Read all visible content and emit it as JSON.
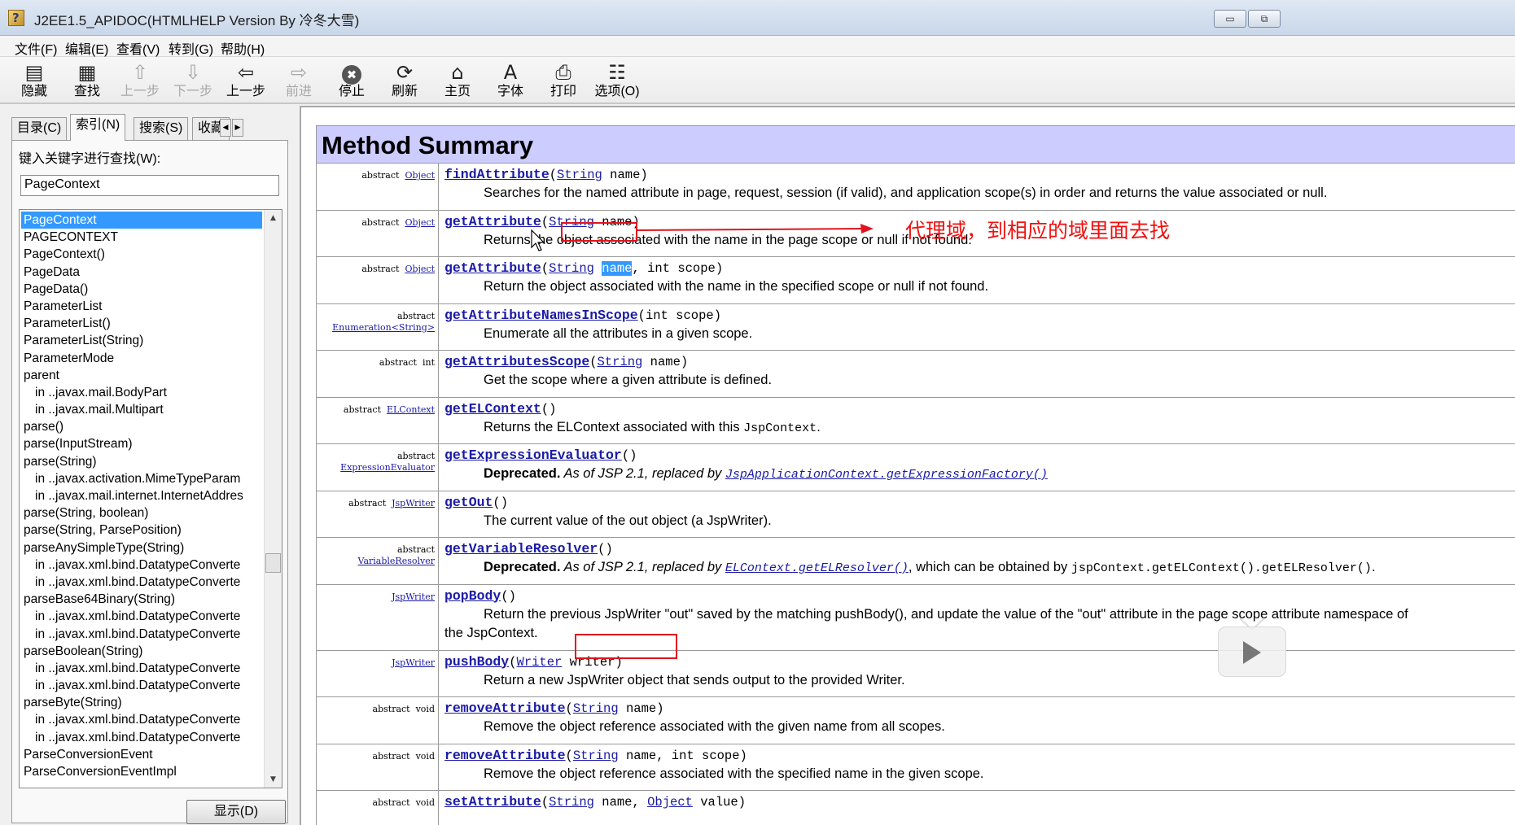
{
  "window": {
    "title": "J2EE1.5_APIDOC(HTMLHELP Version By 冷冬大雪)",
    "min_label": "▭",
    "max_label": "⧉"
  },
  "menubar": [
    "文件(F)",
    "编辑(E)",
    "查看(V)",
    "转到(G)",
    "帮助(H)"
  ],
  "toolbar": [
    {
      "label": "隐藏",
      "icon": "hide-icon",
      "glyph": "▤",
      "enabled": true
    },
    {
      "label": "查找",
      "icon": "find-icon",
      "glyph": "▦",
      "enabled": true
    },
    {
      "label": "上一步",
      "icon": "prev-topic-icon",
      "glyph": "⇧",
      "enabled": false
    },
    {
      "label": "下一步",
      "icon": "next-topic-icon",
      "glyph": "⇩",
      "enabled": false
    },
    {
      "label": "上一步",
      "icon": "back-arrow-icon",
      "glyph": "⇦",
      "enabled": true
    },
    {
      "label": "前进",
      "icon": "forward-arrow-icon",
      "glyph": "⇨",
      "enabled": false
    },
    {
      "label": "停止",
      "icon": "stop-icon",
      "glyph": "✖",
      "enabled": true
    },
    {
      "label": "刷新",
      "icon": "refresh-icon",
      "glyph": "⟳",
      "enabled": true
    },
    {
      "label": "主页",
      "icon": "home-icon",
      "glyph": "⌂",
      "enabled": true
    },
    {
      "label": "字体",
      "icon": "font-icon",
      "glyph": "A",
      "enabled": true
    },
    {
      "label": "打印",
      "icon": "print-icon",
      "glyph": "⎙",
      "enabled": true
    },
    {
      "label": "选项(O)",
      "icon": "options-icon",
      "glyph": "☷",
      "enabled": true
    }
  ],
  "sidebar": {
    "tabs": [
      {
        "label": "目录(C)",
        "active": false
      },
      {
        "label": "索引(N)",
        "active": true
      },
      {
        "label": "搜索(S)",
        "active": false
      },
      {
        "label": "收藏",
        "active": false
      }
    ],
    "keyword_label": "键入关键字进行查找(W):",
    "keyword_value": "PageContext",
    "index_items": [
      {
        "text": "PageContext",
        "sub": false,
        "selected": true
      },
      {
        "text": "PAGECONTEXT",
        "sub": false
      },
      {
        "text": "PageContext()",
        "sub": false
      },
      {
        "text": "PageData",
        "sub": false
      },
      {
        "text": "PageData()",
        "sub": false
      },
      {
        "text": "ParameterList",
        "sub": false
      },
      {
        "text": "ParameterList()",
        "sub": false
      },
      {
        "text": "ParameterList(String)",
        "sub": false
      },
      {
        "text": "ParameterMode",
        "sub": false
      },
      {
        "text": "parent",
        "sub": false
      },
      {
        "text": "in ..javax.mail.BodyPart",
        "sub": true
      },
      {
        "text": "in ..javax.mail.Multipart",
        "sub": true
      },
      {
        "text": "parse()",
        "sub": false
      },
      {
        "text": "parse(InputStream)",
        "sub": false
      },
      {
        "text": "parse(String)",
        "sub": false
      },
      {
        "text": "in ..javax.activation.MimeTypeParam",
        "sub": true
      },
      {
        "text": "in ..javax.mail.internet.InternetAddres",
        "sub": true
      },
      {
        "text": "parse(String, boolean)",
        "sub": false
      },
      {
        "text": "parse(String, ParsePosition)",
        "sub": false
      },
      {
        "text": "parseAnySimpleType(String)",
        "sub": false
      },
      {
        "text": "in ..javax.xml.bind.DatatypeConverte",
        "sub": true
      },
      {
        "text": "in ..javax.xml.bind.DatatypeConverte",
        "sub": true
      },
      {
        "text": "parseBase64Binary(String)",
        "sub": false
      },
      {
        "text": "in ..javax.xml.bind.DatatypeConverte",
        "sub": true
      },
      {
        "text": "in ..javax.xml.bind.DatatypeConverte",
        "sub": true
      },
      {
        "text": "parseBoolean(String)",
        "sub": false
      },
      {
        "text": "in ..javax.xml.bind.DatatypeConverte",
        "sub": true
      },
      {
        "text": "in ..javax.xml.bind.DatatypeConverte",
        "sub": true
      },
      {
        "text": "parseByte(String)",
        "sub": false
      },
      {
        "text": "in ..javax.xml.bind.DatatypeConverte",
        "sub": true
      },
      {
        "text": "in ..javax.xml.bind.DatatypeConverte",
        "sub": true
      },
      {
        "text": "ParseConversionEvent",
        "sub": false
      },
      {
        "text": "ParseConversionEventImpl",
        "sub": false
      }
    ],
    "show_button": "显示(D)"
  },
  "content": {
    "heading": "Method Summary",
    "methods": [
      {
        "mod": "abstract",
        "type": "Object",
        "type_link": true,
        "name": "findAttribute",
        "params": [
          {
            "t": "String",
            "link": true,
            "n": "name"
          }
        ],
        "desc": "Searches for the named attribute in page, request, session (if valid), and application scope(s) in order and returns the value associated or null."
      },
      {
        "mod": "abstract",
        "type": "Object",
        "type_link": true,
        "name": "getAttribute",
        "params": [
          {
            "t": "String",
            "link": true,
            "n": "name"
          }
        ],
        "desc": "Returns the object associated with the name in the page scope or null if not found."
      },
      {
        "mod": "abstract",
        "type": "Object",
        "type_link": true,
        "name": "getAttribute",
        "params": [
          {
            "t": "String",
            "link": true,
            "n": "name",
            "hl": true
          },
          {
            "t": "int",
            "link": false,
            "n": "scope"
          }
        ],
        "desc": "Return the object associated with the name in the specified scope or null if not found."
      },
      {
        "mod": "abstract",
        "type": "Enumeration<String>",
        "type_link": true,
        "two_line_mod": true,
        "name": "getAttributeNamesInScope",
        "params": [
          {
            "t": "int",
            "link": false,
            "n": "scope"
          }
        ],
        "desc": "Enumerate all the attributes in a given scope."
      },
      {
        "mod": "abstract",
        "type": "int",
        "type_link": false,
        "name": "getAttributesScope",
        "params": [
          {
            "t": "String",
            "link": true,
            "n": "name"
          }
        ],
        "desc": "Get the scope where a given attribute is defined."
      },
      {
        "mod": "abstract",
        "type": "ELContext",
        "type_link": true,
        "name": "getELContext",
        "params": [],
        "desc_html_key": "elcontext"
      },
      {
        "mod": "abstract",
        "type": "ExpressionEvaluator",
        "type_link": true,
        "two_line_mod": true,
        "name": "getExpressionEvaluator",
        "params": [],
        "deprecated": {
          "prefix": "Deprecated.",
          "text": " As of JSP 2.1, replaced by ",
          "link": "JspApplicationContext.getExpressionFactory()",
          "suffix": ""
        }
      },
      {
        "mod": "abstract",
        "type": "JspWriter",
        "type_link": true,
        "name": "getOut",
        "params": [],
        "desc": "The current value of the out object (a JspWriter)."
      },
      {
        "mod": "abstract",
        "type": "VariableResolver",
        "type_link": true,
        "two_line_mod": true,
        "name": "getVariableResolver",
        "params": [],
        "deprecated": {
          "prefix": "Deprecated.",
          "text": " As of JSP 2.1, replaced by ",
          "link": "ELContext.getELResolver()",
          "suffix": ", which can be obtained by ",
          "code": "jspContext.getELContext().getELResolver()",
          "end": "."
        }
      },
      {
        "mod": "",
        "type": "JspWriter",
        "type_link": true,
        "name": "popBody",
        "params": [],
        "tall": true,
        "desc": "Return the previous JspWriter \"out\" saved by the matching pushBody(), and update the value of the \"out\" attribute in the page scope attribute namespace of",
        "desc2": "the JspContext."
      },
      {
        "mod": "",
        "type": "JspWriter",
        "type_link": true,
        "name": "pushBody",
        "params": [
          {
            "t": "Writer",
            "link": true,
            "n": "writer"
          }
        ],
        "desc": "Return a new JspWriter object that sends output to the provided Writer."
      },
      {
        "mod": "abstract",
        "type": "void",
        "type_link": false,
        "name": "removeAttribute",
        "params": [
          {
            "t": "String",
            "link": true,
            "n": "name"
          }
        ],
        "desc": "Remove the object reference associated with the given name from all scopes."
      },
      {
        "mod": "abstract",
        "type": "void",
        "type_link": false,
        "name": "removeAttribute",
        "params": [
          {
            "t": "String",
            "link": true,
            "n": "name"
          },
          {
            "t": "int",
            "link": false,
            "n": "scope"
          }
        ],
        "desc": "Remove the object reference associated with the specified name in the given scope."
      },
      {
        "mod": "abstract",
        "type": "void",
        "type_link": false,
        "name": "setAttribute",
        "params": [
          {
            "t": "String",
            "link": true,
            "n": "name"
          },
          {
            "t": "Object",
            "link": true,
            "n": "value"
          }
        ],
        "desc": ""
      }
    ],
    "elcontext_desc": {
      "before": "Returns the ELContext associated with this ",
      "code": "JspContext",
      "after": "."
    }
  },
  "annotation": {
    "text": "代理域，到相应的域里面去找",
    "color": "#e0141c"
  }
}
